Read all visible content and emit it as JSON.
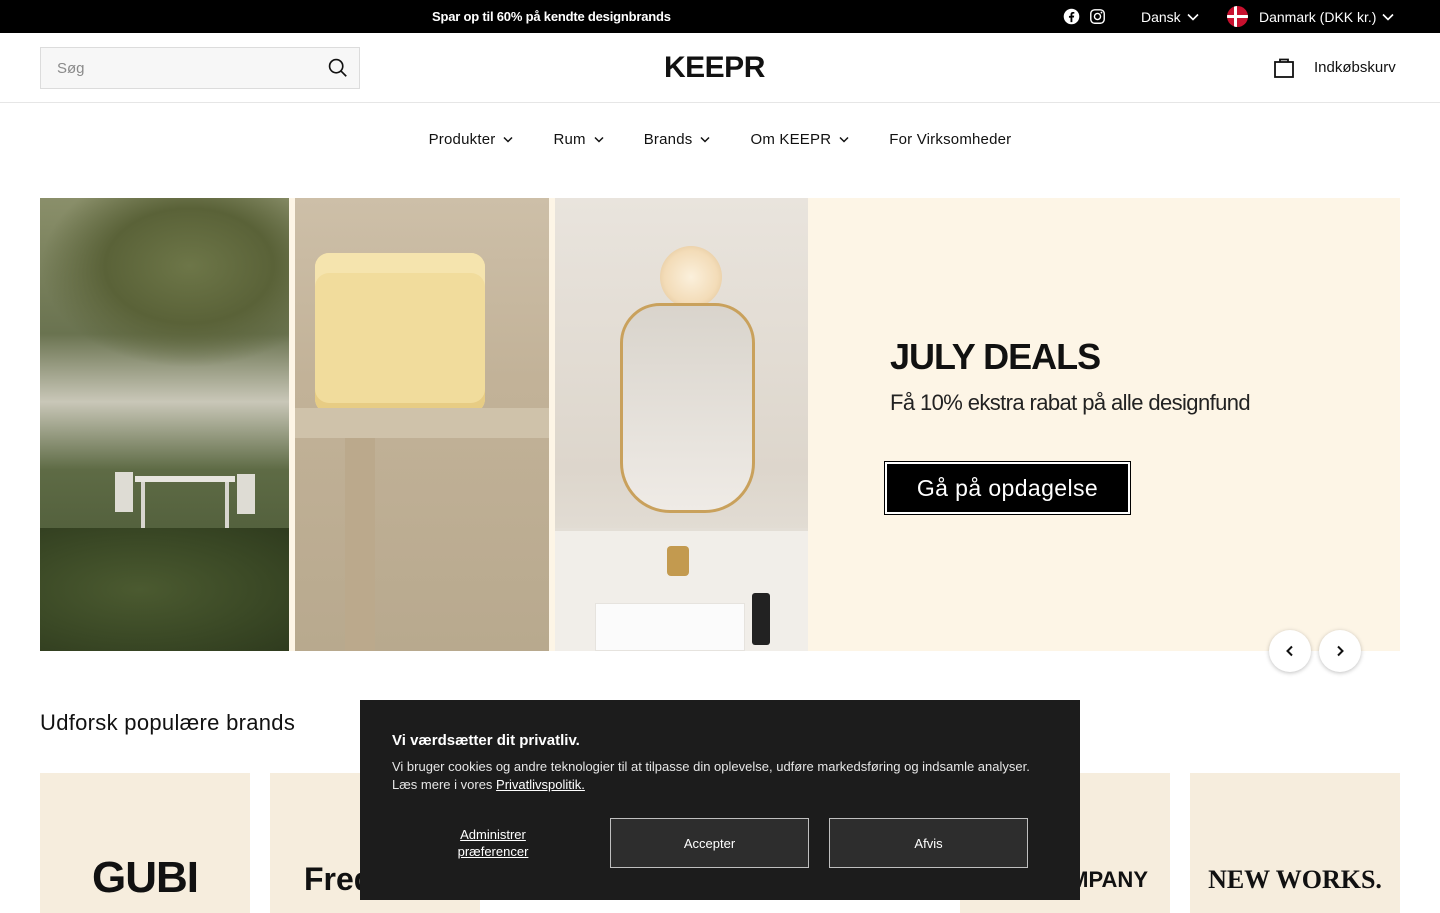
{
  "topbar": {
    "promo": "Spar op til 60% på kendte designbrands",
    "language": "Dansk",
    "country": "Danmark (DKK kr.)"
  },
  "header": {
    "search_placeholder": "Søg",
    "logo": "KEEPR",
    "cart_label": "Indkøbskurv"
  },
  "nav": {
    "items": [
      {
        "label": "Produkter"
      },
      {
        "label": "Rum"
      },
      {
        "label": "Brands"
      },
      {
        "label": "Om KEEPR"
      },
      {
        "label": "For Virksomheder"
      }
    ]
  },
  "hero": {
    "title": "JULY DEALS",
    "subtitle": "Få 10% ekstra rabat på alle designfund",
    "button": "Gå på opdagelse"
  },
  "brands": {
    "title": "Udforsk populære brands",
    "cards": [
      {
        "name": "GUBI"
      },
      {
        "name": "Fred"
      },
      {
        "name": "MPANY"
      },
      {
        "name": "NEW WORKS."
      }
    ]
  },
  "cookie": {
    "title": "Vi værdsætter dit privatliv.",
    "text": "Vi bruger cookies og andre teknologier til at tilpasse din oplevelse, udføre markedsføring og indsamle analyser. Læs mere i vores ",
    "link": "Privatlivspolitik.",
    "preferences": "Administrer præferencer",
    "accept": "Accepter",
    "decline": "Afvis"
  },
  "colors": {
    "hero_bg": "#fdf5e6",
    "brand_card_bg": "#f6eddd",
    "cookie_bg": "#1c1c1c"
  }
}
